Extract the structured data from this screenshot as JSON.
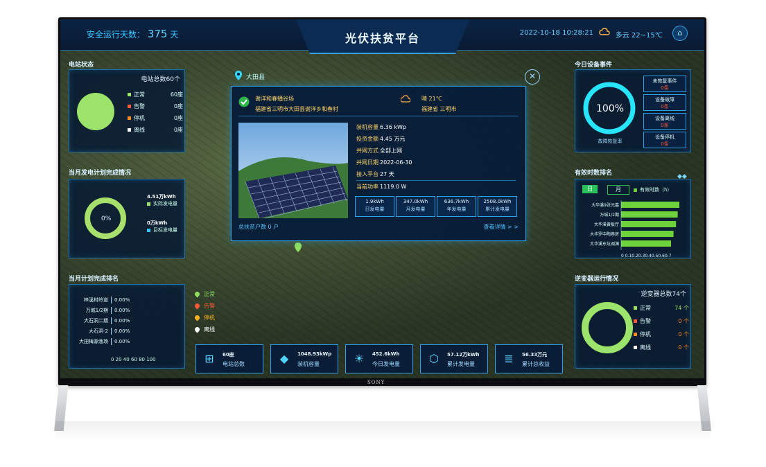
{
  "header": {
    "title": "光伏扶贫平台",
    "safe_days_label": "安全运行天数：",
    "safe_days_value": "375",
    "safe_days_unit": "天",
    "datetime": "2022-10-18  10:28:21",
    "weather": "多云 22~15℃"
  },
  "station_status": {
    "title": "电站状态",
    "total": "电站总数60个",
    "legend": [
      {
        "label": "正常",
        "value": "60座",
        "color": "#9be36a"
      },
      {
        "label": "告警",
        "value": "0座",
        "color": "#ff5a3a"
      },
      {
        "label": "停机",
        "value": "0座",
        "color": "#ff8a1a"
      },
      {
        "label": "离线",
        "value": "0座",
        "color": "#ffffff"
      }
    ]
  },
  "month_plan": {
    "title": "当月发电计划完成情况",
    "percent": "0%",
    "actual_value": "4.51万kWh",
    "actual_label": "实际发电量",
    "target_value": "0万kWh",
    "target_label": "目标发电量"
  },
  "month_rank": {
    "title": "当月计划完成排名",
    "rows": [
      {
        "name": "梓溪村岭道",
        "value": "0.00%"
      },
      {
        "name": "万城1/2期",
        "value": "0.00%"
      },
      {
        "name": "大石洞二期",
        "value": "0.00%"
      },
      {
        "name": "大石洞-2",
        "value": "0.00%"
      },
      {
        "name": "大田梅源渔场",
        "value": "0.00%"
      }
    ],
    "axis": "0  20 40 60 80 100"
  },
  "map": {
    "location_label": "大田县",
    "legend": [
      {
        "label": "正常",
        "color": "#8fe060"
      },
      {
        "label": "告警",
        "color": "#ff5a3a"
      },
      {
        "label": "停机",
        "color": "#ffb020"
      },
      {
        "label": "离线",
        "color": "#ffffff"
      }
    ]
  },
  "popup": {
    "station_name": "谢洋和春蟠谷场",
    "station_address": "福建省三明市大田县谢洋乡和春村",
    "weather": "晴 21℃",
    "weather_region": "福建省 三明市",
    "fields": [
      {
        "label": "装机容量",
        "value": "6.36 kWp"
      },
      {
        "label": "投资金额",
        "value": "4.45 万元"
      },
      {
        "label": "并网方式",
        "value": "全部上网"
      },
      {
        "label": "并网日期",
        "value": "2022-06-30"
      },
      {
        "label": "接入平台",
        "value": "27 天"
      },
      {
        "label": "当前功率",
        "value": "1119.0 W"
      }
    ],
    "stats": [
      {
        "value": "1.9kWh",
        "label": "日发电量"
      },
      {
        "value": "347.0kWh",
        "label": "月发电量"
      },
      {
        "value": "636.7kWh",
        "label": "年发电量"
      },
      {
        "value": "2508.0kWh",
        "label": "累计发电量"
      }
    ],
    "poor_households": "总扶贫户数 0 户",
    "details_link": "查看详情 > >"
  },
  "kpis": [
    {
      "value": "60座",
      "label": "电站总数"
    },
    {
      "value": "1048.93kWp",
      "label": "装机容量"
    },
    {
      "value": "452.6kWh",
      "label": "今日发电量"
    },
    {
      "value": "57.12万kWh",
      "label": "累计发电量"
    },
    {
      "value": "56.33万元",
      "label": "累计总收益"
    }
  ],
  "today_events": {
    "title": "今日设备事件",
    "percent": "100%",
    "caption": "故障恢复率",
    "items": [
      {
        "label": "未恢复事件",
        "value": "0条"
      },
      {
        "label": "设备故障",
        "value": "0条"
      },
      {
        "label": "设备离线",
        "value": "0条"
      },
      {
        "label": "设备停机",
        "value": "0条"
      }
    ]
  },
  "efficiency_rank": {
    "title": "有效时数排名",
    "tab_day": "日",
    "tab_month": "月",
    "legend": "有效时数（h）",
    "axis": "0 0.10.20.30.40.50.60.7"
  },
  "chart_data": {
    "type": "bar",
    "title": "",
    "series": [
      {
        "name": "有效时数（h）",
        "values": [
          0.7,
          0.68,
          0.66,
          0.63,
          0.6
        ]
      }
    ],
    "categories": [
      "大华溪9张元墓",
      "万城1/2期",
      "大华溪黄板厅",
      "大华罗中陶巷房",
      "大华溪东坑调渊"
    ],
    "xlim": [
      0,
      0.7
    ]
  },
  "inverter": {
    "title": "逆变器运行情况",
    "total": "逆变器总数74个",
    "legend": [
      {
        "label": "正常",
        "value": "74 个",
        "color": "#9be36a"
      },
      {
        "label": "告警",
        "value": "0 个",
        "color": "#ff5a3a"
      },
      {
        "label": "停机",
        "value": "0 个",
        "color": "#ff8a1a"
      },
      {
        "label": "离线",
        "value": "0 个",
        "color": "#ffffff"
      }
    ]
  },
  "brand": "SONY"
}
